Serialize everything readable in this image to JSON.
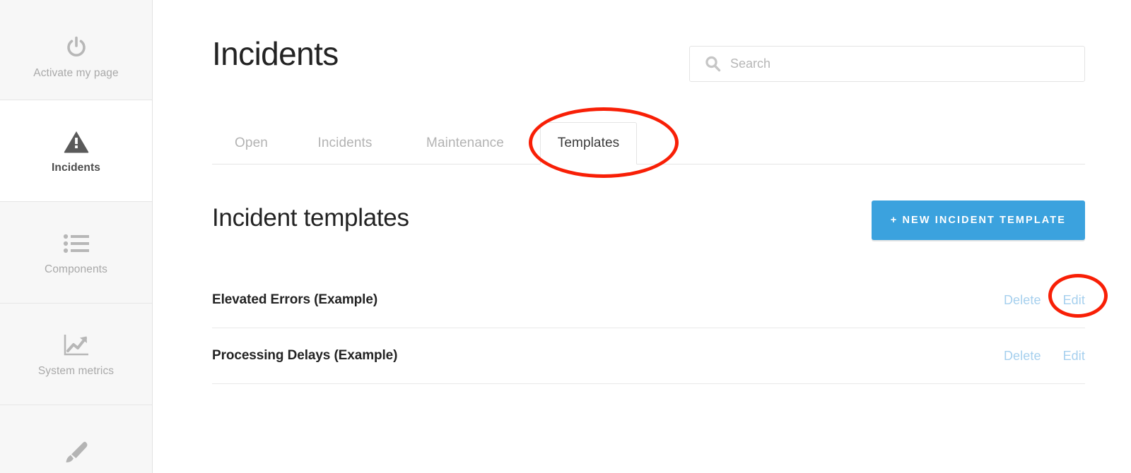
{
  "sidebar": {
    "items": [
      {
        "id": "activate",
        "label": "Activate my page",
        "icon": "power-icon",
        "active": false
      },
      {
        "id": "incidents",
        "label": "Incidents",
        "icon": "warning-triangle-icon",
        "active": true
      },
      {
        "id": "components",
        "label": "Components",
        "icon": "list-icon",
        "active": false
      },
      {
        "id": "system-metrics",
        "label": "System metrics",
        "icon": "chart-line-icon",
        "active": false
      },
      {
        "id": "theme",
        "label": "",
        "icon": "paintbrush-icon",
        "active": false
      }
    ]
  },
  "header": {
    "title": "Incidents"
  },
  "search": {
    "placeholder": "Search",
    "value": "",
    "icon": "search-icon"
  },
  "tabs": [
    {
      "label": "Open",
      "active": false
    },
    {
      "label": "Incidents",
      "active": false
    },
    {
      "label": "Maintenance",
      "active": false
    },
    {
      "label": "Templates",
      "active": true
    }
  ],
  "section": {
    "title": "Incident templates",
    "new_button_label": "+ NEW INCIDENT TEMPLATE"
  },
  "templates": {
    "rows": [
      {
        "name": "Elevated Errors (Example)",
        "delete_label": "Delete",
        "edit_label": "Edit"
      },
      {
        "name": "Processing Delays (Example)",
        "delete_label": "Delete",
        "edit_label": "Edit"
      }
    ]
  },
  "annotations": [
    {
      "id": "annot-templates",
      "target": "tab-templates",
      "shape": "ellipse",
      "color": "#f81f06"
    },
    {
      "id": "annot-edit",
      "target": "edit-link-row-0",
      "shape": "ellipse",
      "color": "#f81f06"
    }
  ],
  "colors": {
    "accent_blue": "#3ba2de",
    "link_blue": "#a6d0ee",
    "annotation_red": "#f81f06",
    "sidebar_bg": "#f7f7f7",
    "text_dark": "#232323",
    "text_muted": "#b3b3b3"
  }
}
